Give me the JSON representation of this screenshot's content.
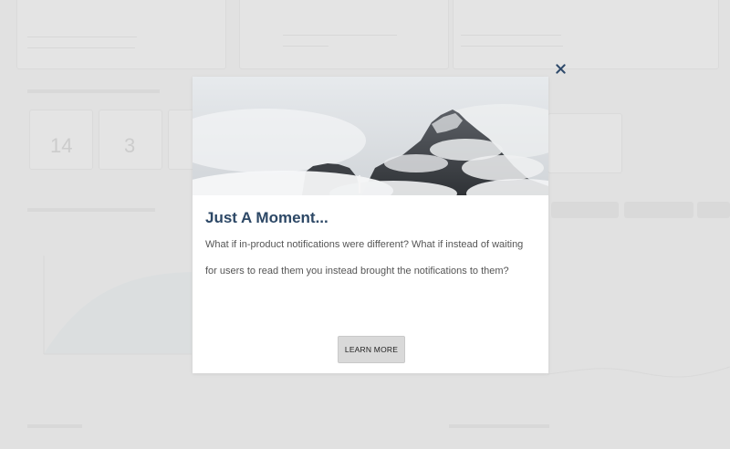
{
  "background": {
    "stat_tiles": [
      "14",
      "3"
    ]
  },
  "modal": {
    "close_icon": "close-icon",
    "image": "misty-mountain-photo",
    "title": "Just A Moment...",
    "body": "What if in-product notifications were different? What if instead of waiting for users to read them you instead brought the notifications to them?",
    "button_label": "LEARN MORE"
  },
  "colors": {
    "title": "#2d4866",
    "close": "#2f4a6b",
    "button_bg": "#d9d9d9"
  }
}
